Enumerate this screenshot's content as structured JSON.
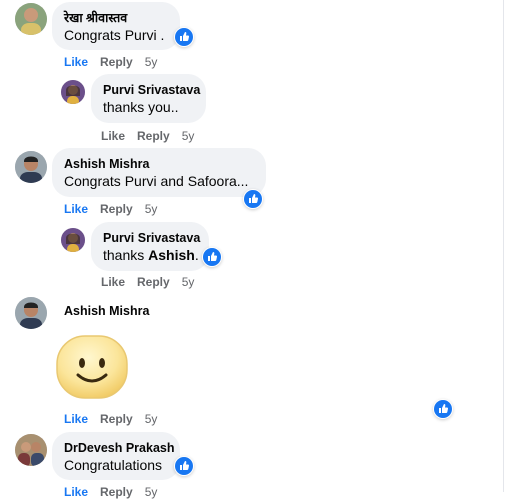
{
  "comments": [
    {
      "author": "रेखा श्रीवास्तव",
      "text": "Congrats Purvi .",
      "actions": {
        "like": "Like",
        "reply": "Reply",
        "time": "5y"
      },
      "reply": {
        "author": "Purvi Srivastava",
        "text": "thanks you..",
        "actions": {
          "like": "Like",
          "reply": "Reply",
          "time": "5y"
        }
      }
    },
    {
      "author": "Ashish Mishra",
      "text": "Congrats Purvi and Safoora...",
      "actions": {
        "like": "Like",
        "reply": "Reply",
        "time": "5y"
      },
      "reply": {
        "author": "Purvi Srivastava",
        "text_prefix": "thanks ",
        "text_mention": "Ashish",
        "text_suffix": ".",
        "actions": {
          "like": "Like",
          "reply": "Reply",
          "time": "5y"
        }
      }
    },
    {
      "author": "Ashish Mishra",
      "sticker": "smiley-face-sticker",
      "actions": {
        "like": "Like",
        "reply": "Reply",
        "time": "5y"
      }
    },
    {
      "author": "DrDevesh Prakash",
      "text": "Congratulations",
      "actions": {
        "like": "Like",
        "reply": "Reply",
        "time": "5y"
      }
    }
  ],
  "colors": {
    "like_blue": "#1877f2",
    "bubble_bg": "#f0f2f5",
    "meta_gray": "#65676b"
  },
  "icons": {
    "reaction": "like-reaction-icon"
  }
}
